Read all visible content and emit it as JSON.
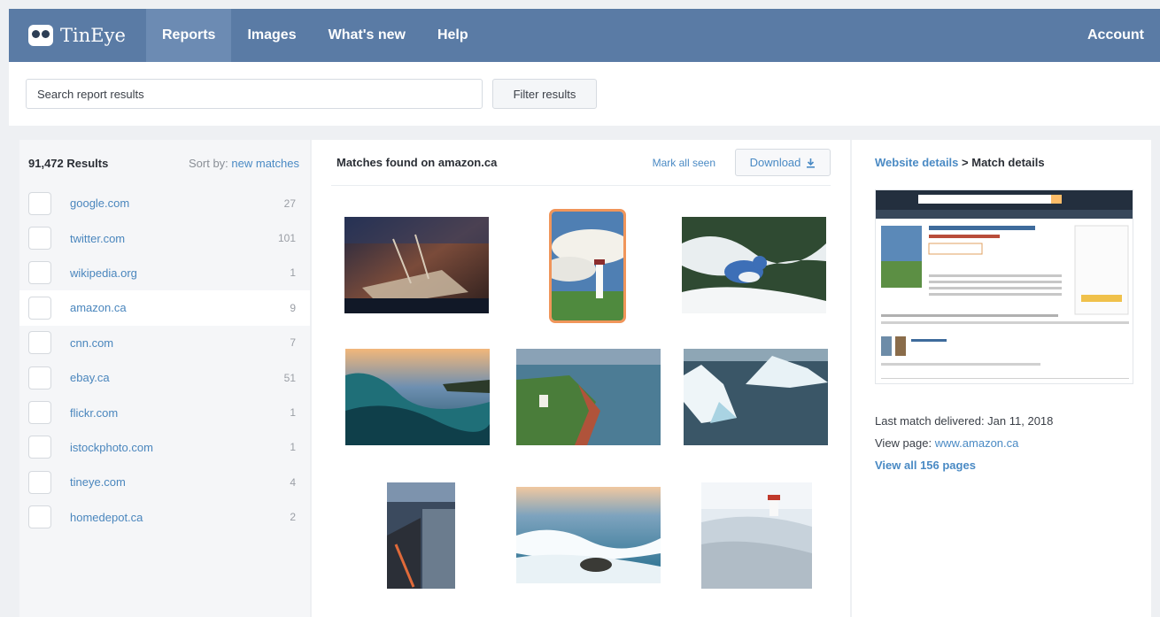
{
  "nav": {
    "brand": "TinEye",
    "items": [
      "Reports",
      "Images",
      "What's new",
      "Help"
    ],
    "account": "Account"
  },
  "search": {
    "placeholder": "Search report results",
    "filter_label": "Filter results"
  },
  "sidebar": {
    "results_count": "91,472 Results",
    "sort_prefix": "Sort by:",
    "sort_value": "new matches",
    "sites": [
      {
        "name": "google.com",
        "count": "27"
      },
      {
        "name": "twitter.com",
        "count": "101"
      },
      {
        "name": "wikipedia.org",
        "count": "1"
      },
      {
        "name": "amazon.ca",
        "count": "9"
      },
      {
        "name": "cnn.com",
        "count": "7"
      },
      {
        "name": "ebay.ca",
        "count": "51"
      },
      {
        "name": "flickr.com",
        "count": "1"
      },
      {
        "name": "istockphoto.com",
        "count": "1"
      },
      {
        "name": "tineye.com",
        "count": "4"
      },
      {
        "name": "homedepot.ca",
        "count": "2"
      }
    ]
  },
  "center": {
    "title": "Matches found on amazon.ca",
    "mark_all_seen": "Mark all seen",
    "download": "Download"
  },
  "right": {
    "crumb_link": "Website details",
    "crumb_sep": ">",
    "crumb_current": "Match details",
    "last_match": "Last match delivered: Jan 11, 2018",
    "view_page_prefix": "View page:",
    "view_page_link": "www.amazon.ca",
    "view_all": "View all 156 pages"
  },
  "colors": {
    "nav_bg": "#5a7ba5",
    "link": "#4a8ac4",
    "selected_outline": "#f0955a"
  }
}
